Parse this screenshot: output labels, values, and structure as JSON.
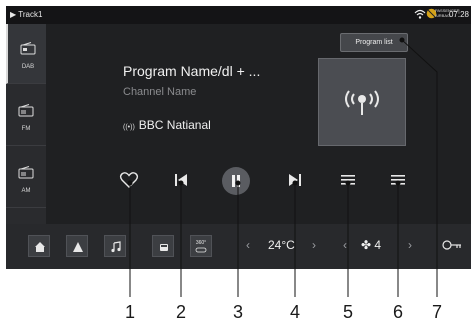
{
  "status": {
    "track": "Track1",
    "time": "07:28",
    "airbag_label": "PASSENGER AIRBAG"
  },
  "sidebar": {
    "items": [
      {
        "label": "DAB",
        "icon": "radio-dab-icon",
        "active": true
      },
      {
        "label": "FM",
        "icon": "radio-fm-icon",
        "active": false
      },
      {
        "label": "AM",
        "icon": "radio-am-icon",
        "active": false
      }
    ]
  },
  "main": {
    "program_name": "Program Name/dl + ...",
    "channel_name": "Channel Name",
    "station": "BBC Natianal"
  },
  "program_list_label": "Program list",
  "bottom": {
    "climate_label": "360°",
    "temperature": "24°C",
    "fan_speed": "4"
  },
  "callouts": [
    "1",
    "2",
    "3",
    "4",
    "5",
    "6",
    "7"
  ]
}
